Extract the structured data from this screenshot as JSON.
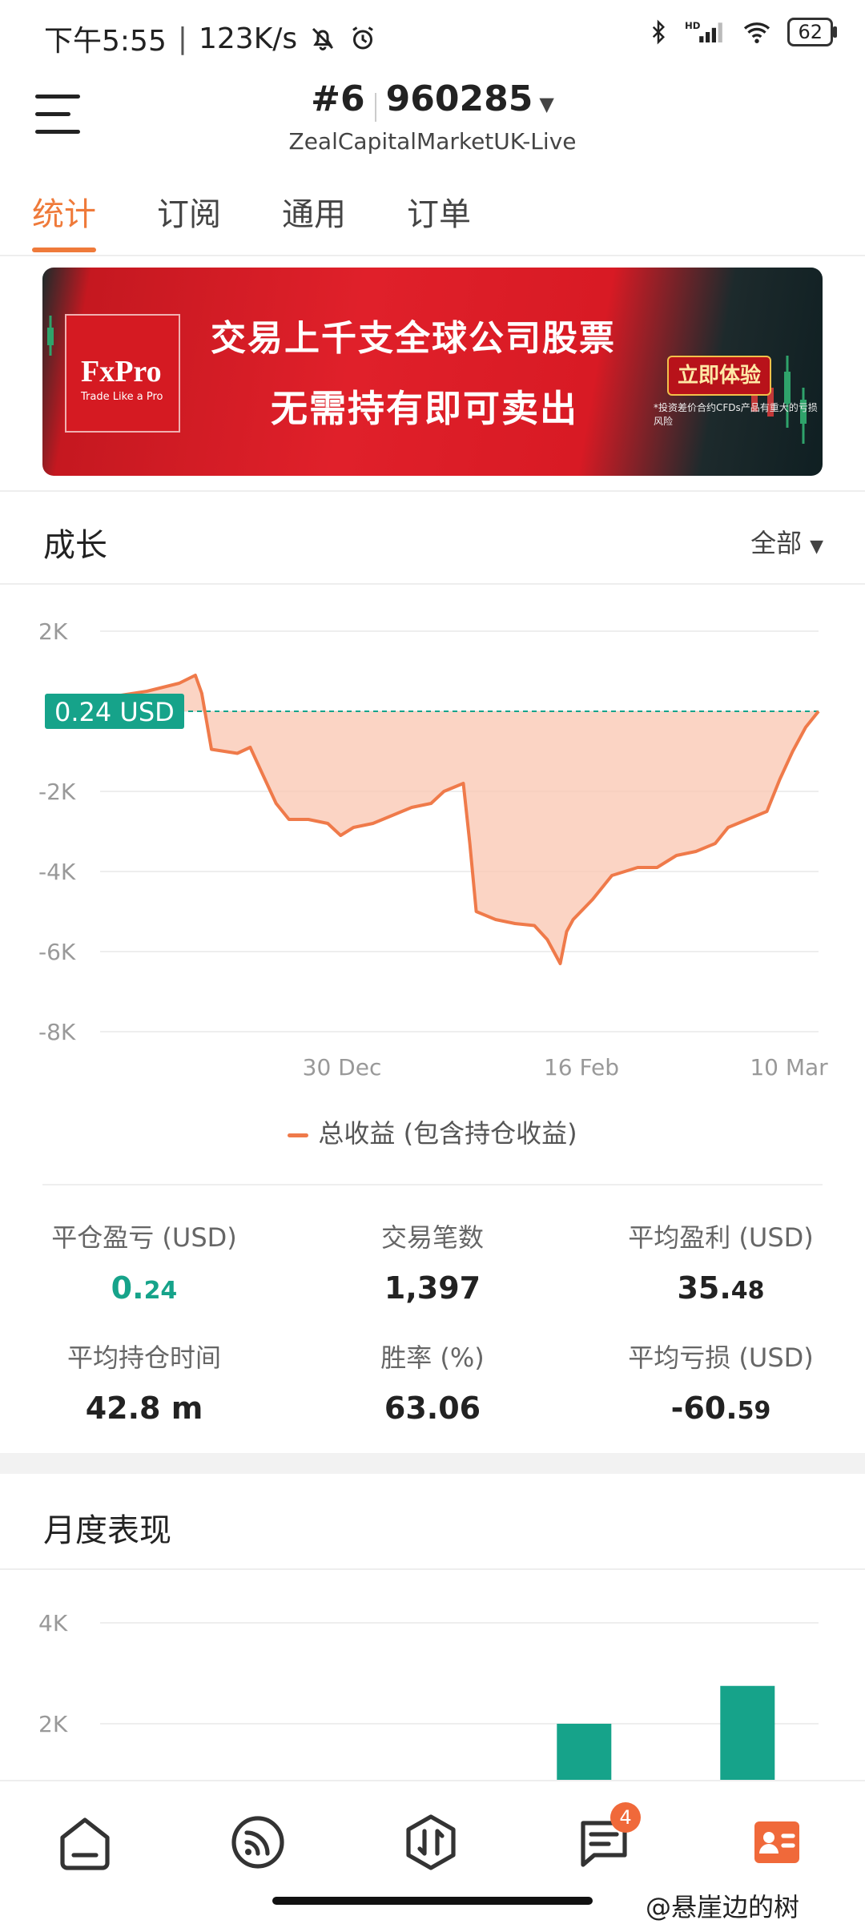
{
  "status_bar": {
    "time": "下午5:55",
    "network_speed": "123K/s",
    "battery": "62",
    "icons": [
      "mute-bell-icon",
      "alarm-icon",
      "bluetooth-icon",
      "hd-signal-icon",
      "wifi-icon",
      "battery-icon"
    ]
  },
  "header": {
    "account_index": "#6",
    "account_number": "960285",
    "server": "ZealCapitalMarketUK-Live"
  },
  "tabs": [
    {
      "label": "统计",
      "active": true
    },
    {
      "label": "订阅",
      "active": false
    },
    {
      "label": "通用",
      "active": false
    },
    {
      "label": "订单",
      "active": false
    }
  ],
  "banner": {
    "brand": "FxPro",
    "tagline": "Trade Like a Pro",
    "headline": "交易上千支全球公司股票",
    "subheadline": "无需持有即可卖出",
    "cta": "立即体验",
    "fine_print": "*投资差价合约CFDs产品有重大的亏损风险"
  },
  "growth": {
    "title": "成长",
    "filter": "全部",
    "current_label": "0.24 USD",
    "legend": "总收益 (包含持仓收益)"
  },
  "chart_data": [
    {
      "type": "area",
      "title": "成长",
      "xlabel": "",
      "ylabel": "",
      "ylim": [
        -8000,
        2000
      ],
      "yticks": [
        "2K",
        "0",
        "-2K",
        "-4K",
        "-6K",
        "-8K"
      ],
      "yticks_shown": [
        "2K",
        "-2K",
        "-4K",
        "-6K",
        "-8K"
      ],
      "xticks": [
        "30 Dec",
        "16 Feb",
        "10 Mar"
      ],
      "grid": true,
      "legend": "bottom",
      "colors": {
        "line": "#ef7a4a",
        "fill": "#f9c6b0",
        "baseline": "#16a38a"
      },
      "series": [
        {
          "name": "总收益 (包含持仓收益)",
          "points": [
            [
              0.0,
              350
            ],
            [
              0.06,
              500
            ],
            [
              0.11,
              700
            ],
            [
              0.135,
              900
            ],
            [
              0.145,
              450
            ],
            [
              0.16,
              -950
            ],
            [
              0.2,
              -1050
            ],
            [
              0.22,
              -900
            ],
            [
              0.24,
              -1600
            ],
            [
              0.26,
              -2300
            ],
            [
              0.28,
              -2700
            ],
            [
              0.31,
              -2700
            ],
            [
              0.34,
              -2800
            ],
            [
              0.36,
              -3100
            ],
            [
              0.38,
              -2900
            ],
            [
              0.41,
              -2800
            ],
            [
              0.44,
              -2600
            ],
            [
              0.47,
              -2400
            ],
            [
              0.5,
              -2300
            ],
            [
              0.52,
              -2000
            ],
            [
              0.55,
              -1800
            ],
            [
              0.56,
              -3300
            ],
            [
              0.57,
              -5000
            ],
            [
              0.6,
              -5200
            ],
            [
              0.63,
              -5300
            ],
            [
              0.66,
              -5350
            ],
            [
              0.68,
              -5700
            ],
            [
              0.7,
              -6300
            ],
            [
              0.71,
              -5500
            ],
            [
              0.72,
              -5200
            ],
            [
              0.75,
              -4700
            ],
            [
              0.78,
              -4100
            ],
            [
              0.82,
              -3900
            ],
            [
              0.85,
              -3900
            ],
            [
              0.88,
              -3600
            ],
            [
              0.91,
              -3500
            ],
            [
              0.94,
              -3300
            ],
            [
              0.96,
              -2900
            ],
            [
              0.99,
              -2700
            ],
            [
              1.02,
              -2500
            ],
            [
              1.04,
              -1700
            ],
            [
              1.06,
              -1000
            ],
            [
              1.08,
              -400
            ],
            [
              1.1,
              0
            ]
          ]
        }
      ]
    },
    {
      "type": "bar",
      "title": "月度表现",
      "ylim": [
        0,
        4000
      ],
      "yticks": [
        "4K",
        "2K"
      ],
      "colors": {
        "bar": "#16a38a"
      },
      "series": [
        {
          "values": [
            {
              "x_pos": 0.67,
              "value": 2000
            },
            {
              "x_pos": 0.9,
              "value": 2750
            }
          ]
        }
      ]
    }
  ],
  "stats": [
    {
      "label": "平仓盈亏 (USD)",
      "value_main": "0.",
      "value_small": "24",
      "color": "#16a38a"
    },
    {
      "label": "交易笔数",
      "value_main": "1,397",
      "value_small": "",
      "color": "#222222"
    },
    {
      "label": "平均盈利 (USD)",
      "value_main": "35.",
      "value_small": "48",
      "color": "#222222"
    },
    {
      "label": "平均持仓时间",
      "value_main": "42.8 m",
      "value_small": "",
      "color": "#222222"
    },
    {
      "label": "胜率 (%)",
      "value_main": "63.06",
      "value_small": "",
      "color": "#222222"
    },
    {
      "label": "平均亏损 (USD)",
      "value_main": "-60.",
      "value_small": "59",
      "color": "#222222"
    }
  ],
  "monthly": {
    "title": "月度表现"
  },
  "bottom_nav": [
    {
      "icon": "home-icon"
    },
    {
      "icon": "signals-icon"
    },
    {
      "icon": "trade-icon"
    },
    {
      "icon": "messages-icon",
      "badge": "4"
    },
    {
      "icon": "profile-icon",
      "active": true
    }
  ],
  "watermark": "@悬崖边的树"
}
